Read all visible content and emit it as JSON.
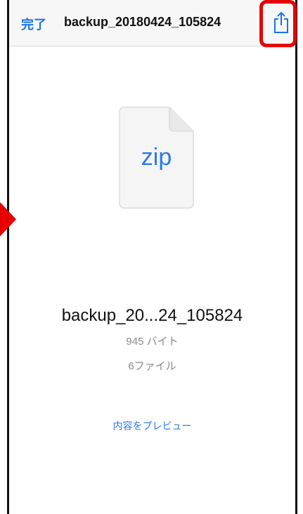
{
  "navbar": {
    "done_label": "完了",
    "title": "backup_20180424_105824",
    "share_icon": "share-icon"
  },
  "file": {
    "icon": "zip-file-icon",
    "extension": "zip",
    "name": "backup_20...24_105824",
    "size": "945 バイト",
    "count": "6ファイル"
  },
  "actions": {
    "preview_label": "内容をプレビュー"
  },
  "colors": {
    "accent": "#2a7be4",
    "highlight": "#e60000"
  }
}
